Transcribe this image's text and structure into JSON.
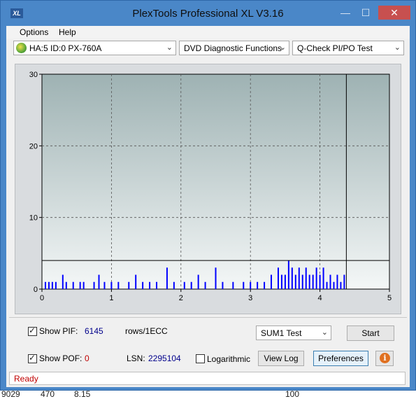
{
  "window": {
    "title": "PlexTools Professional XL V3.16",
    "icon_text": "XL",
    "minimize": "—",
    "maximize": "☐",
    "close": "✕"
  },
  "menu": {
    "options": "Options",
    "help": "Help"
  },
  "toolbar": {
    "drive": "HA:5 ID:0  PX-760A",
    "function": "DVD Diagnostic Functions",
    "test": "Q-Check PI/PO Test"
  },
  "chart_data": {
    "type": "bar",
    "title": "",
    "xlabel": "",
    "ylabel": "",
    "xlim": [
      0,
      5
    ],
    "ylim": [
      0,
      30
    ],
    "x_ticks": [
      "0",
      "1",
      "2",
      "3",
      "4",
      "5"
    ],
    "y_ticks": [
      "0",
      "10",
      "20",
      "30"
    ],
    "grid": true,
    "threshold_line": 4,
    "marker_x": 4.38,
    "bar_color": "#0000ff",
    "series": [
      {
        "name": "PIF",
        "bins": [
          {
            "x": 0.05,
            "v": 1
          },
          {
            "x": 0.1,
            "v": 1
          },
          {
            "x": 0.15,
            "v": 1
          },
          {
            "x": 0.2,
            "v": 1
          },
          {
            "x": 0.3,
            "v": 2
          },
          {
            "x": 0.35,
            "v": 1
          },
          {
            "x": 0.45,
            "v": 1
          },
          {
            "x": 0.55,
            "v": 1
          },
          {
            "x": 0.6,
            "v": 1
          },
          {
            "x": 0.75,
            "v": 1
          },
          {
            "x": 0.82,
            "v": 2
          },
          {
            "x": 0.9,
            "v": 1
          },
          {
            "x": 1.0,
            "v": 1
          },
          {
            "x": 1.1,
            "v": 1
          },
          {
            "x": 1.25,
            "v": 1
          },
          {
            "x": 1.35,
            "v": 2
          },
          {
            "x": 1.45,
            "v": 1
          },
          {
            "x": 1.55,
            "v": 1
          },
          {
            "x": 1.65,
            "v": 1
          },
          {
            "x": 1.8,
            "v": 3
          },
          {
            "x": 1.9,
            "v": 1
          },
          {
            "x": 2.05,
            "v": 1
          },
          {
            "x": 2.15,
            "v": 1
          },
          {
            "x": 2.25,
            "v": 2
          },
          {
            "x": 2.35,
            "v": 1
          },
          {
            "x": 2.5,
            "v": 3
          },
          {
            "x": 2.6,
            "v": 1
          },
          {
            "x": 2.75,
            "v": 1
          },
          {
            "x": 2.9,
            "v": 1
          },
          {
            "x": 3.0,
            "v": 1
          },
          {
            "x": 3.1,
            "v": 1
          },
          {
            "x": 3.2,
            "v": 1
          },
          {
            "x": 3.3,
            "v": 2
          },
          {
            "x": 3.4,
            "v": 3
          },
          {
            "x": 3.45,
            "v": 2
          },
          {
            "x": 3.5,
            "v": 2
          },
          {
            "x": 3.55,
            "v": 4
          },
          {
            "x": 3.6,
            "v": 3
          },
          {
            "x": 3.65,
            "v": 2
          },
          {
            "x": 3.7,
            "v": 3
          },
          {
            "x": 3.75,
            "v": 2
          },
          {
            "x": 3.8,
            "v": 3
          },
          {
            "x": 3.85,
            "v": 2
          },
          {
            "x": 3.9,
            "v": 2
          },
          {
            "x": 3.95,
            "v": 3
          },
          {
            "x": 4.0,
            "v": 2
          },
          {
            "x": 4.05,
            "v": 3
          },
          {
            "x": 4.1,
            "v": 1
          },
          {
            "x": 4.15,
            "v": 2
          },
          {
            "x": 4.2,
            "v": 1
          },
          {
            "x": 4.25,
            "v": 2
          },
          {
            "x": 4.3,
            "v": 1
          },
          {
            "x": 4.35,
            "v": 2
          }
        ]
      }
    ]
  },
  "controls": {
    "show_pif_label": "Show PIF:",
    "pif_value": "6145",
    "rows_label": "rows/1ECC",
    "show_pof_label": "Show POF:",
    "pof_value": "0",
    "lsn_label": "LSN:",
    "lsn_value": "2295104",
    "logarithmic_label": "Logarithmic",
    "sum_test": "SUM1 Test",
    "start": "Start",
    "view_log": "View Log",
    "preferences": "Preferences",
    "info": "i"
  },
  "status": {
    "text": "Ready"
  },
  "background_row": {
    "c1": "9029",
    "c2": "470",
    "c3": "8.15",
    "c4": "100"
  }
}
